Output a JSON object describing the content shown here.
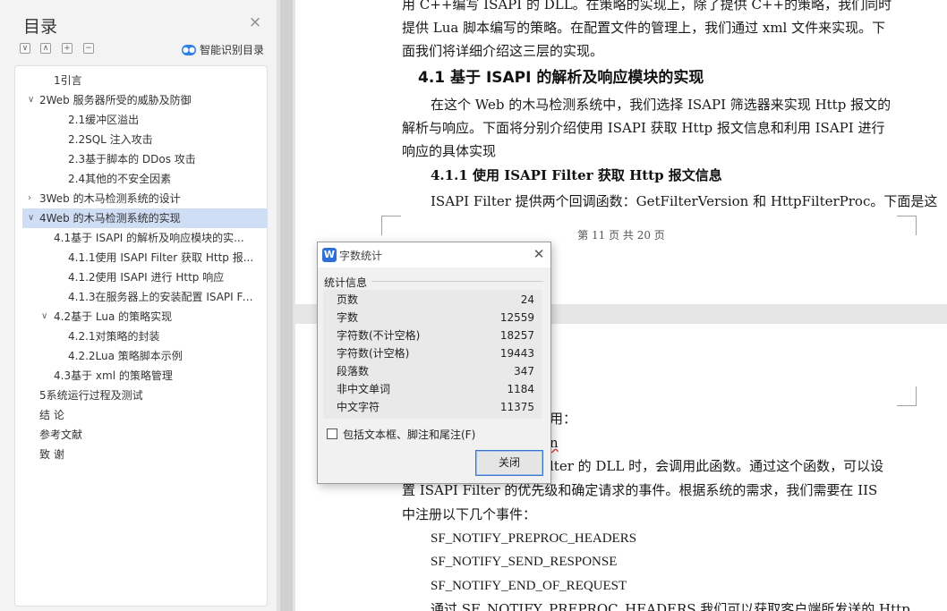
{
  "nav": {
    "title": "目录",
    "smart_toc_label": "智能识别目录",
    "toolbar_buttons": [
      "collapse-all",
      "expand-level",
      "add-item",
      "remove-item"
    ]
  },
  "toc": {
    "items": [
      {
        "label": "1引言"
      },
      {
        "label": "2Web 服务器所受的威胁及防御",
        "arrow": "∨"
      },
      {
        "label": "2.1缓冲区溢出"
      },
      {
        "label": "2.2SQL 注入攻击"
      },
      {
        "label": "2.3基于脚本的 DDos 攻击"
      },
      {
        "label": "2.4其他的不安全因素"
      },
      {
        "label": "3Web 的木马检测系统的设计",
        "arrow": "›"
      },
      {
        "label": "4Web 的木马检测系统的实现",
        "arrow": "∨"
      },
      {
        "label": "4.1基于 ISAPI 的解析及响应模块的实..."
      },
      {
        "label": "4.1.1使用 ISAPI Filter 获取 Http 报..."
      },
      {
        "label": "4.1.2使用 ISAPI 进行 Http 响应"
      },
      {
        "label": "4.1.3在服务器上的安装配置 ISAPI Fi..."
      },
      {
        "label": "4.2基于 Lua 的策略实现",
        "arrow": "∨"
      },
      {
        "label": "4.2.1对策略的封装"
      },
      {
        "label": "4.2.2Lua 策略脚本示例"
      },
      {
        "label": "4.3基于 xml 的策略管理"
      },
      {
        "label": "5系统运行过程及测试"
      },
      {
        "label": "结    论"
      },
      {
        "label": "参考文献"
      },
      {
        "label": "致    谢"
      }
    ]
  },
  "document": {
    "page1_lines": [
      "用 C++编写 ISAPI 的 DLL。在策略的实现上，除了提供 C++的策略，我们同时",
      "提供 Lua 脚本编写的策略。在配置文件的管理上，我们通过 xml 文件来实现。下",
      "面我们将详细介绍这三层的实现。"
    ],
    "heading_41": "4.1 基于 ISAPI  的解析及响应模块的实现",
    "para_41": [
      "在这个 Web 的木马检测系统中，我们选择 ISAPI 筛选器来实现 Http 报文的",
      "解析与响应。下面将分别介绍使用 ISAPI 获取 Http 报文信息和利用 ISAPI 进行",
      "响应的具体实现"
    ],
    "heading_411": "4.1.1    使用 ISAPI Filter 获取 Http 报文信息",
    "para_411": "ISAPI Filter 提供两个回调函数：GetFilterVersion 和 HttpFilterProc。下面是这",
    "footer": "第 11 页 共 20 页",
    "page2_partial1": "用：",
    "page2_partial2": "n",
    "page2_line3": "lter 的 DLL 时，会调用此函数。通过这个函数，可以设",
    "page2_line4": "置 ISAPI Filter 的优先级和确定请求的事件。根据系统的需求，我们需要在 IIS",
    "page2_line5": "中注册以下几个事件：",
    "code_lines": [
      "SF_NOTIFY_PREPROC_HEADERS",
      "SF_NOTIFY_SEND_RESPONSE",
      "SF_NOTIFY_END_OF_REQUEST"
    ],
    "last_line": "通过 SF_NOTIFY_PREPROC_HEADERS 我们可以获取客户端所发送的 Http"
  },
  "dialog": {
    "title": "字数统计",
    "group_label": "统计信息",
    "stats": [
      {
        "label": "页数",
        "value": "24"
      },
      {
        "label": "字数",
        "value": "12559"
      },
      {
        "label": "字符数(不计空格)",
        "value": "18257"
      },
      {
        "label": "字符数(计空格)",
        "value": "19443"
      },
      {
        "label": "段落数",
        "value": "347"
      },
      {
        "label": "非中文单词",
        "value": "1184"
      },
      {
        "label": "中文字符",
        "value": "11375"
      }
    ],
    "checkbox_label": "包括文本框、脚注和尾注(F)",
    "checkbox_checked": false,
    "close_label": "关闭"
  },
  "colors": {
    "selected_toc": "#cfddf5",
    "button_border": "#3a74c9",
    "app_icon": "#2f6fd8"
  }
}
